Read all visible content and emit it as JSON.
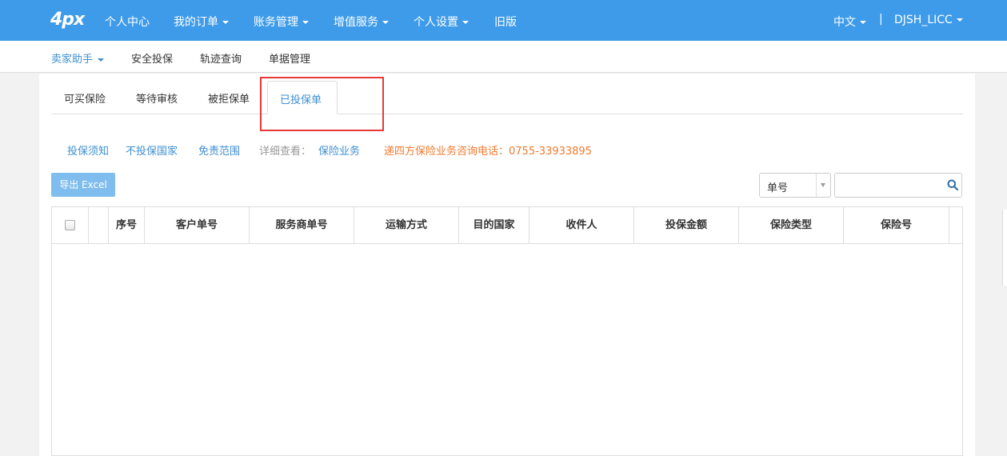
{
  "topnav": {
    "logo": "4px",
    "items": [
      {
        "label": "个人中心",
        "dropdown": false
      },
      {
        "label": "我的订单",
        "dropdown": true
      },
      {
        "label": "账务管理",
        "dropdown": true
      },
      {
        "label": "增值服务",
        "dropdown": true
      },
      {
        "label": "个人设置",
        "dropdown": true
      },
      {
        "label": "旧版",
        "dropdown": false
      }
    ],
    "language": "中文",
    "separator": "|",
    "user": "DJSH_LICC"
  },
  "subnav": {
    "items": [
      {
        "label": "卖家助手",
        "active": true,
        "dropdown": true
      },
      {
        "label": "安全投保",
        "active": false
      },
      {
        "label": "轨迹查询",
        "active": false
      },
      {
        "label": "单据管理",
        "active": false
      }
    ]
  },
  "tabs": {
    "items": [
      "可买保险",
      "等待审核",
      "被拒保单",
      "已投保单"
    ],
    "active_index": 3
  },
  "info_links": {
    "notice": "投保须知",
    "excluded_countries": "不投保国家",
    "exemption": "免责范围",
    "detail_label": "详细查看：",
    "insurance_business": "保险业务",
    "hotline": "递四方保险业务咨询电话：0755-33933895"
  },
  "toolbar": {
    "export_label": "导出 Excel",
    "search_field_selected": "单号",
    "search_value": ""
  },
  "table": {
    "columns": [
      "序号",
      "客户单号",
      "服务商单号",
      "运输方式",
      "目的国家",
      "收件人",
      "投保金额",
      "保险类型",
      "保险号"
    ],
    "rows": []
  },
  "colors": {
    "nav_bg": "#3d9be9",
    "link": "#3d8fd1",
    "hotline": "#f07a30",
    "highlight": "#e53935"
  }
}
